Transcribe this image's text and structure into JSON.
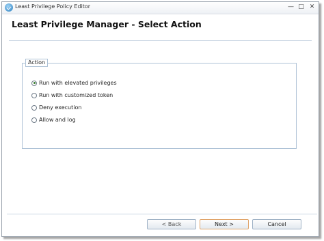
{
  "window": {
    "title": "Least Privilege Policy Editor",
    "controls": {
      "minimize": "—",
      "maximize": "□",
      "close": "✕"
    }
  },
  "page": {
    "title": "Least Privilege Manager - Select Action"
  },
  "action_group": {
    "legend": "Action",
    "options": [
      {
        "label": "Run with elevated privileges",
        "selected": true
      },
      {
        "label": "Run with customized token",
        "selected": false
      },
      {
        "label": "Deny execution",
        "selected": false
      },
      {
        "label": "Allow and log",
        "selected": false
      }
    ]
  },
  "buttons": {
    "back": "< Back",
    "next": "Next >",
    "cancel": "Cancel"
  },
  "colors": {
    "accent_border": "#aec2d6",
    "default_button_border": "#e0a46a",
    "selected_radio": "#3a7f2f"
  }
}
